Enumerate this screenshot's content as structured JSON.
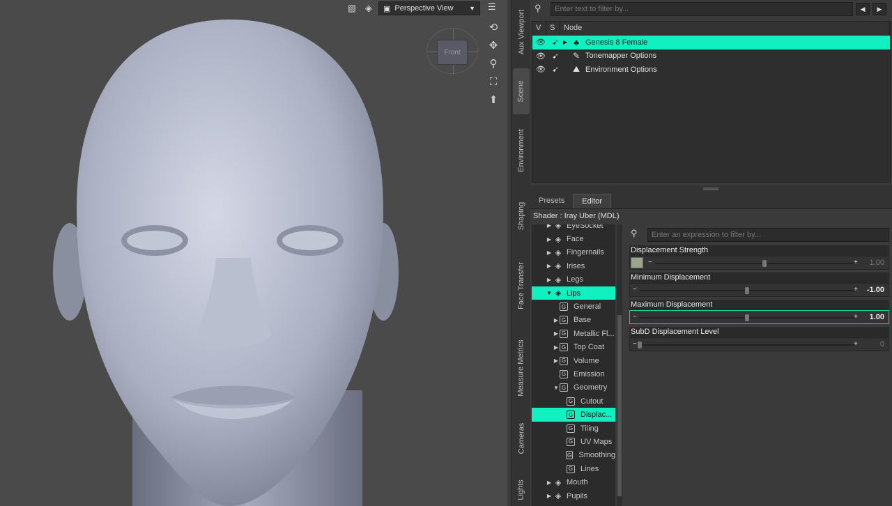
{
  "viewport": {
    "view_select": "Perspective View",
    "nav_cube_label": "Front"
  },
  "vtabs": [
    "Aux Viewport",
    "Scene",
    "Environment",
    "Shaping",
    "Face Transfer",
    "Measure Metrics",
    "Cameras",
    "Lights"
  ],
  "scene": {
    "filter_placeholder": "Enter text to filter by...",
    "columns": [
      "V",
      "S",
      "Node"
    ],
    "nodes": [
      "Genesis 8 Female",
      "Tonemapper Options",
      "Environment Options"
    ]
  },
  "surfaces": {
    "tabs": [
      "Presets",
      "Editor"
    ],
    "shader": "Shader :  Iray Uber (MDL)",
    "materials": [
      "EyeSocket",
      "Face",
      "Fingernails",
      "Irises",
      "Legs",
      "Lips",
      "General",
      "Base",
      "Metallic Fl...",
      "Top Coat",
      "Volume",
      "Emission",
      "Geometry",
      "Cutout",
      "Displac...",
      "Tiling",
      "UV Maps",
      "Smoothing",
      "Lines",
      "Mouth",
      "Pupils"
    ],
    "prop_filter_placeholder": "Enter an expression to filter by...",
    "properties": [
      {
        "name": "Displacement Strength",
        "value": "1.00",
        "level": 0.55
      },
      {
        "name": "Minimum Displacement",
        "value": "-1.00",
        "level": 0.5
      },
      {
        "name": "Maximum Displacement",
        "value": "1.00",
        "level": 0.5
      },
      {
        "name": "SubD Displacement Level",
        "value": "0",
        "level": 0.0
      }
    ]
  },
  "colors": {
    "selection": "#10f0c0",
    "panel": "#3a3a3a",
    "viewport_bg": "#4a4a4a"
  }
}
